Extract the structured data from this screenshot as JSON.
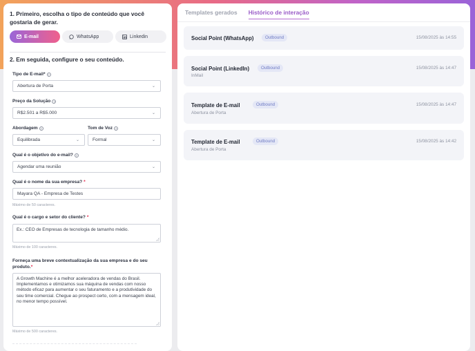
{
  "step1": {
    "title": "1. Primeiro, escolha o tipo de conteúdo que você gostaria de gerar."
  },
  "content_types": [
    {
      "label": "E-mail",
      "icon": "mail-icon",
      "active": true
    },
    {
      "label": "WhatsApp",
      "icon": "whatsapp-icon",
      "active": false
    },
    {
      "label": "Linkedin",
      "icon": "linkedin-icon",
      "active": false
    }
  ],
  "step2": {
    "title": "2. Em seguida, configure o seu conteúdo."
  },
  "form": {
    "email_type": {
      "label": "Tipo de E-mail*",
      "value": "Abertura de Porta"
    },
    "price": {
      "label": "Preço da Solução",
      "value": "R$2.501 a R$5.000"
    },
    "approach": {
      "label": "Abordagem",
      "value": "Equilibrada"
    },
    "tone": {
      "label": "Tom de Voz",
      "value": "Formal"
    },
    "objective": {
      "label": "Qual é o objetivo do e-mail?",
      "value": "Agendar uma reunião"
    },
    "company": {
      "label": "Qual é o nome da sua empresa?",
      "value": "Mayara QA - Empresa de Testes",
      "hint": "Máximo de 50 caracteres."
    },
    "client_role": {
      "label": "Qual é o cargo e setor do cliente?",
      "placeholder": "Ex.: CEO de Empresas de tecnologia de tamanho médio.",
      "hint": "Máximo de 100 caracteres."
    },
    "context": {
      "label": "Forneça uma breve contextualização da sua empresa e do seu produto.",
      "value": "A Growth Machine é a melhor aceleradora de vendas do Brasil. Implementamos e otimizamos sua máquina de vendas com nosso método eficaz para aumentar o seu faturamento e a produtividade do seu time comercial. Chegue ao prospect certo, com a mensagem ideal, no menor tempo possível.",
      "hint": "Máximo de 500 caracteres."
    }
  },
  "tabs": [
    {
      "label": "Templates gerados",
      "active": false
    },
    {
      "label": "Histórico de interação",
      "active": true
    }
  ],
  "history": [
    {
      "title": "Social Point (WhatsApp)",
      "badge": "Outbound",
      "subtitle": "",
      "date": "15/08/2025 às 14:55"
    },
    {
      "title": "Social Point (LinkedIn)",
      "badge": "Outbound",
      "subtitle": "InMail",
      "date": "15/08/2025 às 14:47"
    },
    {
      "title": "Template de E-mail",
      "badge": "Outbound",
      "subtitle": "Abertura de Porta",
      "date": "15/08/2025 às 14:47"
    },
    {
      "title": "Template de E-mail",
      "badge": "Outbound",
      "subtitle": "Abertura de Porta",
      "date": "15/08/2025 às 14:42"
    }
  ]
}
